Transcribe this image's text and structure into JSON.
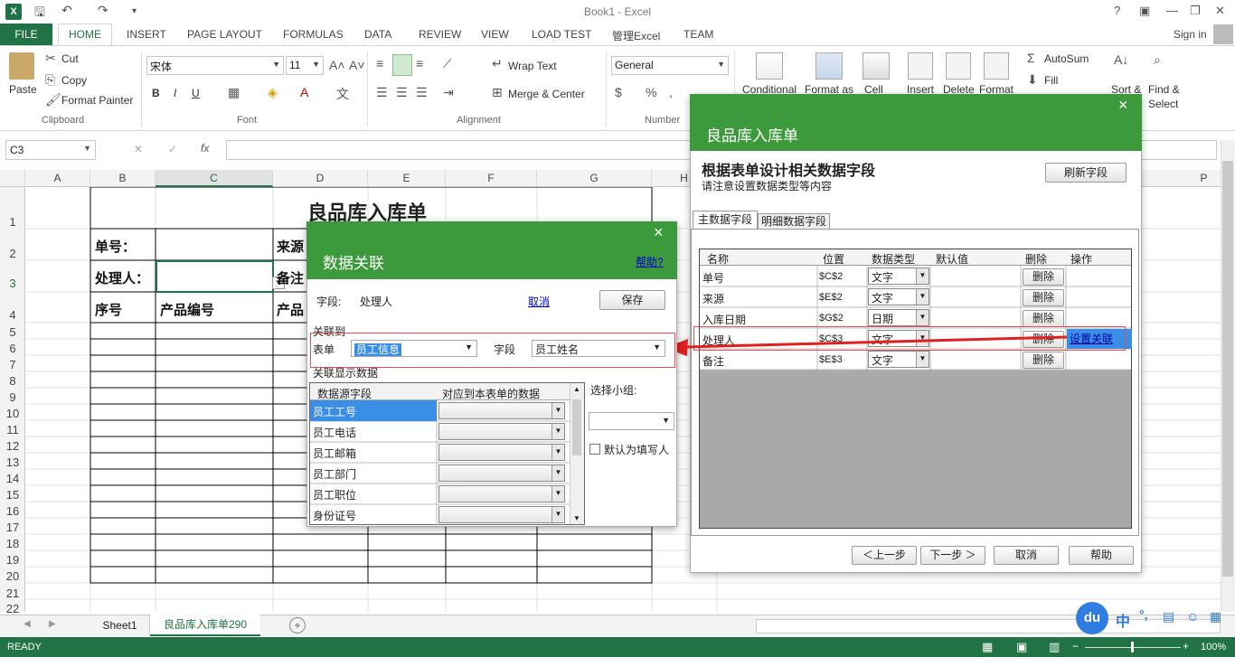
{
  "app": {
    "title": "Book1 - Excel",
    "sign_in": "Sign in",
    "help": "?"
  },
  "ribbon_tabs": [
    "FILE",
    "HOME",
    "INSERT",
    "PAGE LAYOUT",
    "FORMULAS",
    "DATA",
    "REVIEW",
    "VIEW",
    "LOAD TEST",
    "管理Excel",
    "TEAM"
  ],
  "clipboard": {
    "paste": "Paste",
    "cut": "Cut",
    "copy": "Copy",
    "format_painter": "Format Painter",
    "group": "Clipboard"
  },
  "font": {
    "name": "宋体",
    "size": "11",
    "group": "Font",
    "bold": "B",
    "italic": "I",
    "underline": "U"
  },
  "alignment": {
    "wrap": "Wrap Text",
    "merge": "Merge & Center",
    "group": "Alignment"
  },
  "number": {
    "format": "General",
    "group": "Number",
    "percent": "%"
  },
  "styles": {
    "conditional": "Conditional",
    "format_as": "Format as",
    "cell": "Cell"
  },
  "cells": {
    "insert": "Insert",
    "delete": "Delete",
    "format": "Format"
  },
  "editing": {
    "autosum": "AutoSum",
    "fill": "Fill",
    "sort": "Sort &",
    "find": "Find &",
    "select": "Select"
  },
  "formula_bar": {
    "name_box": "C3",
    "fx": "fx",
    "cancel": "✕",
    "enter": "✓"
  },
  "columns": [
    "A",
    "B",
    "C",
    "D",
    "E",
    "F",
    "G",
    "H",
    "P"
  ],
  "rows": [
    "1",
    "2",
    "3",
    "4",
    "5",
    "6",
    "7",
    "8",
    "9",
    "10",
    "11",
    "12",
    "13",
    "14",
    "15",
    "16",
    "17",
    "18",
    "19",
    "20",
    "21",
    "22"
  ],
  "sheet": {
    "title": "良品库入库单",
    "b2": "单号：",
    "d2": "来源",
    "b3": "处理人：",
    "d3": "备注",
    "b4": "序号",
    "c4": "产品编号",
    "d4": "产品"
  },
  "sheet_tabs": [
    "Sheet1",
    "良品库入库单290"
  ],
  "status": {
    "ready": "READY",
    "zoom": "100%"
  },
  "ime": {
    "logo": "du",
    "lang": "中",
    "punct": "°,"
  },
  "wizard": {
    "title": "良品库入库单",
    "heading": "根据表单设计相关数据字段",
    "subheading": "请注意设置数据类型等内容",
    "refresh": "刷新字段",
    "tabs": [
      "主数据字段",
      "明细数据字段"
    ],
    "headers": [
      "名称",
      "位置",
      "数据类型",
      "默认值",
      "删除",
      "操作"
    ],
    "rows": [
      {
        "name": "单号",
        "pos": "$C$2",
        "type": "文字",
        "del": "删除",
        "op": ""
      },
      {
        "name": "来源",
        "pos": "$E$2",
        "type": "文字",
        "del": "删除",
        "op": ""
      },
      {
        "name": "入库日期",
        "pos": "$G$2",
        "type": "日期",
        "del": "删除",
        "op": ""
      },
      {
        "name": "处理人",
        "pos": "$C$3",
        "type": "文字",
        "del": "删除",
        "op": "设置关联"
      },
      {
        "name": "备注",
        "pos": "$E$3",
        "type": "文字",
        "del": "删除",
        "op": ""
      }
    ],
    "prev": "＜上一步",
    "next": "下一步 ＞",
    "cancel": "取消",
    "help": "帮助",
    "close": "×"
  },
  "relation": {
    "title": "数据关联",
    "help": "帮助?",
    "close": "×",
    "field_label": "字段:",
    "field_value": "处理人",
    "cancel": "取消",
    "save": "保存",
    "link_to": "关联到",
    "table_label": "表单",
    "table_value": "员工信息",
    "field2_label": "字段",
    "field2_value": "员工姓名",
    "display_label": "关联显示数据",
    "headers": [
      "数据源字段",
      "对应到本表单的数据"
    ],
    "items": [
      "员工工号",
      "员工电话",
      "员工邮箱",
      "员工部门",
      "员工职位",
      "身份证号"
    ],
    "group_label": "选择小组:",
    "default_writer": "默认为填写人"
  }
}
